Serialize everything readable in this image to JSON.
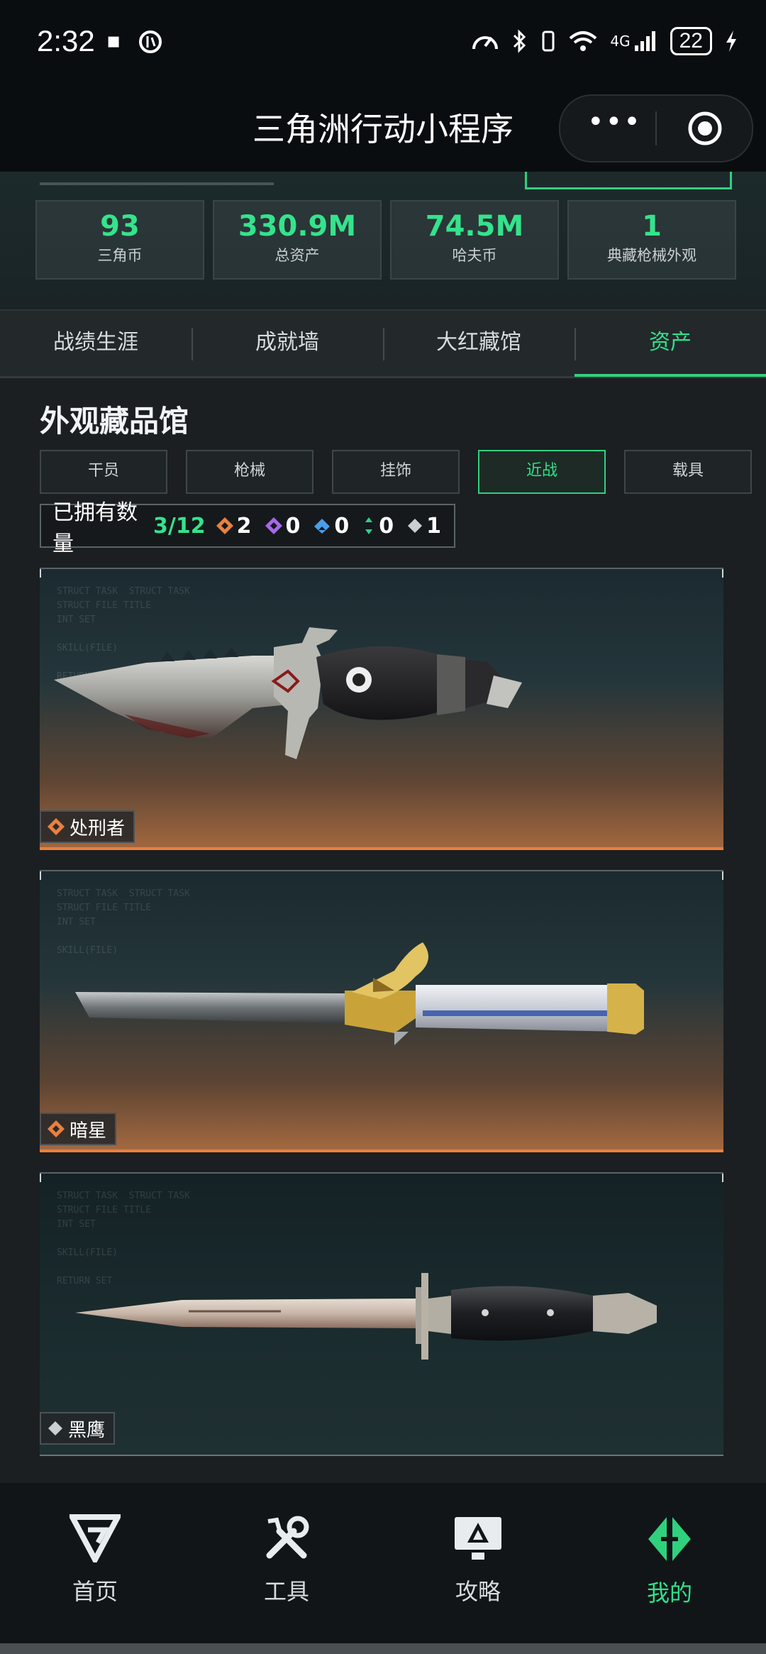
{
  "status_bar": {
    "time": "2:32",
    "network": "4G",
    "battery": "22"
  },
  "title_bar": {
    "title": "三角洲行动小程序",
    "more_icon": "ellipsis-icon",
    "close_icon": "target-close-icon"
  },
  "stats": [
    {
      "value": "93",
      "label": "三角币"
    },
    {
      "value": "330.9M",
      "label": "总资产"
    },
    {
      "value": "74.5M",
      "label": "哈夫币"
    },
    {
      "value": "1",
      "label": "典藏枪械外观"
    }
  ],
  "tabs": [
    {
      "label": "战绩生涯"
    },
    {
      "label": "成就墙"
    },
    {
      "label": "大红藏馆"
    },
    {
      "label": "资产",
      "active": true
    }
  ],
  "collection": {
    "title": "外观藏品馆",
    "filters": [
      {
        "label": "干员"
      },
      {
        "label": "枪械"
      },
      {
        "label": "挂饰"
      },
      {
        "label": "近战",
        "active": true
      },
      {
        "label": "载具"
      }
    ],
    "owned_label": "已拥有数量",
    "owned_count": "3/12",
    "rarity_counts": [
      {
        "icon": "orange-diamond-icon",
        "color": "#e9803f",
        "count": "2"
      },
      {
        "icon": "purple-diamond-icon",
        "color": "#a669e8",
        "count": "0"
      },
      {
        "icon": "blue-diamond-icon",
        "color": "#4a9ee8",
        "count": "0"
      },
      {
        "icon": "green-diamond-icon",
        "color": "#2fcf8e",
        "count": "0"
      },
      {
        "icon": "gray-diamond-icon",
        "color": "#c9cfd2",
        "count": "1"
      }
    ],
    "items": [
      {
        "name": "处刑者",
        "rarity_icon": "orange-diamond-icon",
        "rarity_color": "#e9803f"
      },
      {
        "name": "暗星",
        "rarity_icon": "orange-diamond-icon",
        "rarity_color": "#e9803f"
      },
      {
        "name": "黑鹰",
        "rarity_icon": "gray-diamond-icon",
        "rarity_color": "#c9cfd2"
      }
    ]
  },
  "bottom_nav": [
    {
      "label": "首页",
      "icon": "delta-logo-icon"
    },
    {
      "label": "工具",
      "icon": "tools-icon"
    },
    {
      "label": "攻略",
      "icon": "monitor-guide-icon"
    },
    {
      "label": "我的",
      "icon": "profile-logo-icon",
      "active": true
    }
  ],
  "colors": {
    "accent": "#2fd17d",
    "orange_rarity": "#e9803f"
  }
}
